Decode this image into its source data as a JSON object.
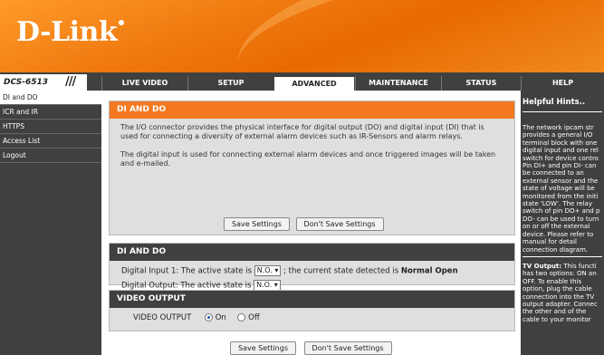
{
  "brand": {
    "logo_text": "D-Link"
  },
  "model": {
    "name": "DCS-6513",
    "slashes": "///"
  },
  "tabs": [
    {
      "label": "LIVE VIDEO"
    },
    {
      "label": "SETUP"
    },
    {
      "label": "ADVANCED"
    },
    {
      "label": "MAINTENANCE"
    },
    {
      "label": "STATUS"
    },
    {
      "label": "HELP"
    }
  ],
  "sidebar": {
    "items": [
      {
        "label": "DI and DO"
      },
      {
        "label": "ICR and IR"
      },
      {
        "label": "HTTPS"
      },
      {
        "label": "Access List"
      },
      {
        "label": "Logout"
      }
    ]
  },
  "intro": {
    "title": "DI AND DO",
    "para1": "The I/O connector provides the physical interface for digital output (DO) and digital input (DI) that is used for connecting a diversity of external alarm devices such as IR-Sensors and alarm relays.",
    "para2": "The digital input is used for connecting external alarm devices and once triggered images will be taken and e-mailed.",
    "save_label": "Save Settings",
    "dont_save_label": "Don't Save Settings"
  },
  "dido": {
    "title": "DI AND DO",
    "di_label": "Digital Input 1: The active state is",
    "di_value": "N.O.",
    "di_state_prefix": "; the current state detected is",
    "di_state_value": "Normal Open",
    "do_label": "Digital Output: The active state is",
    "do_value": "N.O."
  },
  "video_output": {
    "title": "VIDEO OUTPUT",
    "label": "VIDEO OUTPUT",
    "option_on": "On",
    "option_off": "Off",
    "selected": "On"
  },
  "footer": {
    "save_label": "Save Settings",
    "dont_save_label": "Don't Save Settings"
  },
  "hints": {
    "title": "Helpful Hints..",
    "text1": "The network ipcam str provides a general I/O terminal block with one digital input and one rel switch for device contro Pin DI+ and pin DI- can be connected to an external sensor and the state of voltage will be monitored from the initi state 'LOW'. The relay switch of pin DO+ and p DO- can be used to turn on or off the external device. Please refer to manual for detail connection diagram.",
    "text2_bold": "TV Output:",
    "text2": " This functi has two options: ON an OFF. To enable this option, plug the cable connection into the TV output adapter. Connec the other and of the cable to your monitor"
  },
  "colors": {
    "accent": "#f47920",
    "nav_bg": "#404040",
    "panel_bg": "#dfdfdf"
  }
}
